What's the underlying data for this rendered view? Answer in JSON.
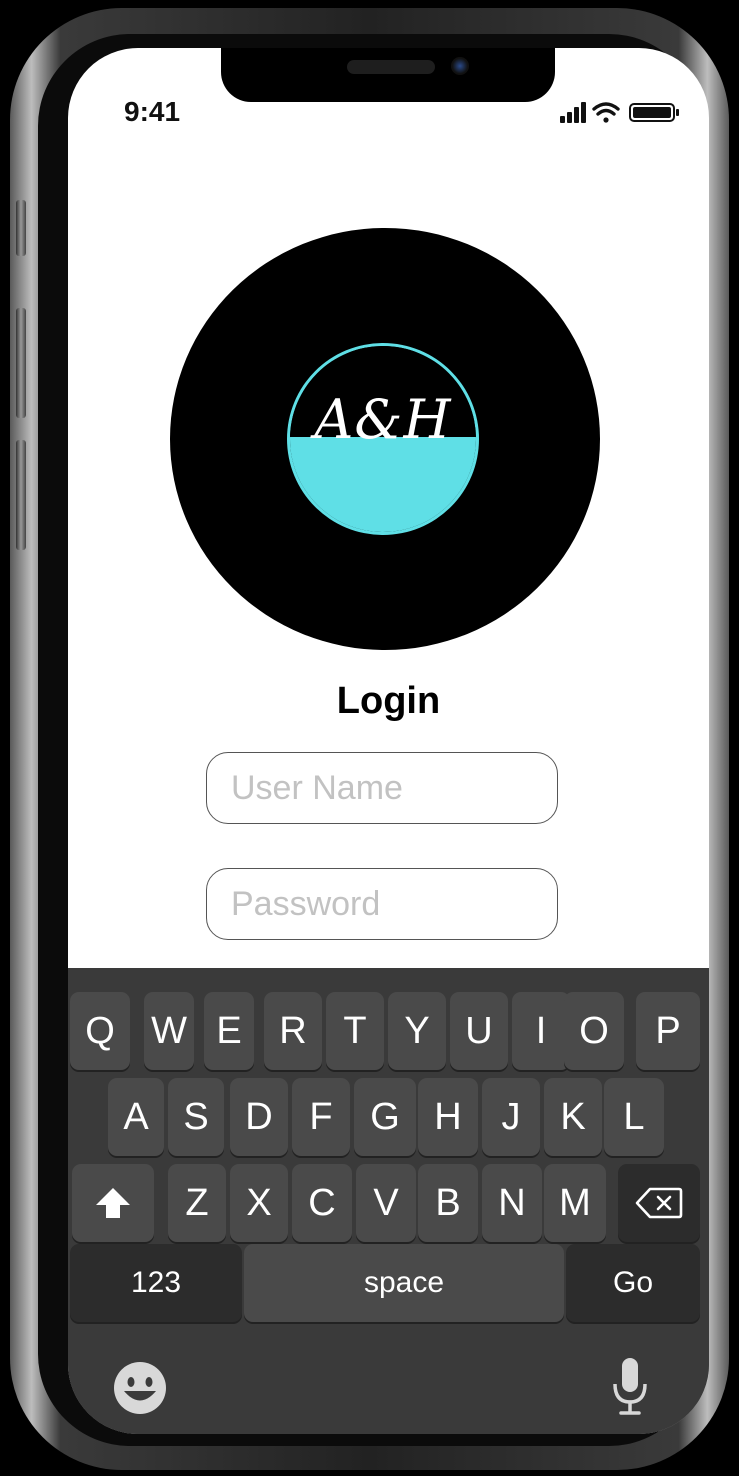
{
  "status_bar": {
    "time": "9:41"
  },
  "login": {
    "title": "Login",
    "username_placeholder": "User Name",
    "password_placeholder": "Password",
    "logo_text": "A&H"
  },
  "keyboard": {
    "row1": [
      "Q",
      "W",
      "E",
      "R",
      "T",
      "Y",
      "U",
      "I",
      "O",
      "P"
    ],
    "row2": [
      "A",
      "S",
      "D",
      "F",
      "G",
      "H",
      "J",
      "K",
      "L"
    ],
    "row3": [
      "Z",
      "X",
      "C",
      "V",
      "B",
      "N",
      "M"
    ],
    "numbers_label": "123",
    "space_label": "space",
    "go_label": "Go"
  },
  "icons": {
    "shift": "shift-icon",
    "delete": "backspace-icon",
    "emoji": "emoji-icon",
    "mic": "microphone-icon",
    "signal": "signal-icon",
    "wifi": "wifi-icon",
    "battery": "battery-icon"
  },
  "colors": {
    "logo_accent": "#5fdfe6",
    "keyboard_bg": "#3a3a3a",
    "key_bg": "#4a4a4a"
  }
}
